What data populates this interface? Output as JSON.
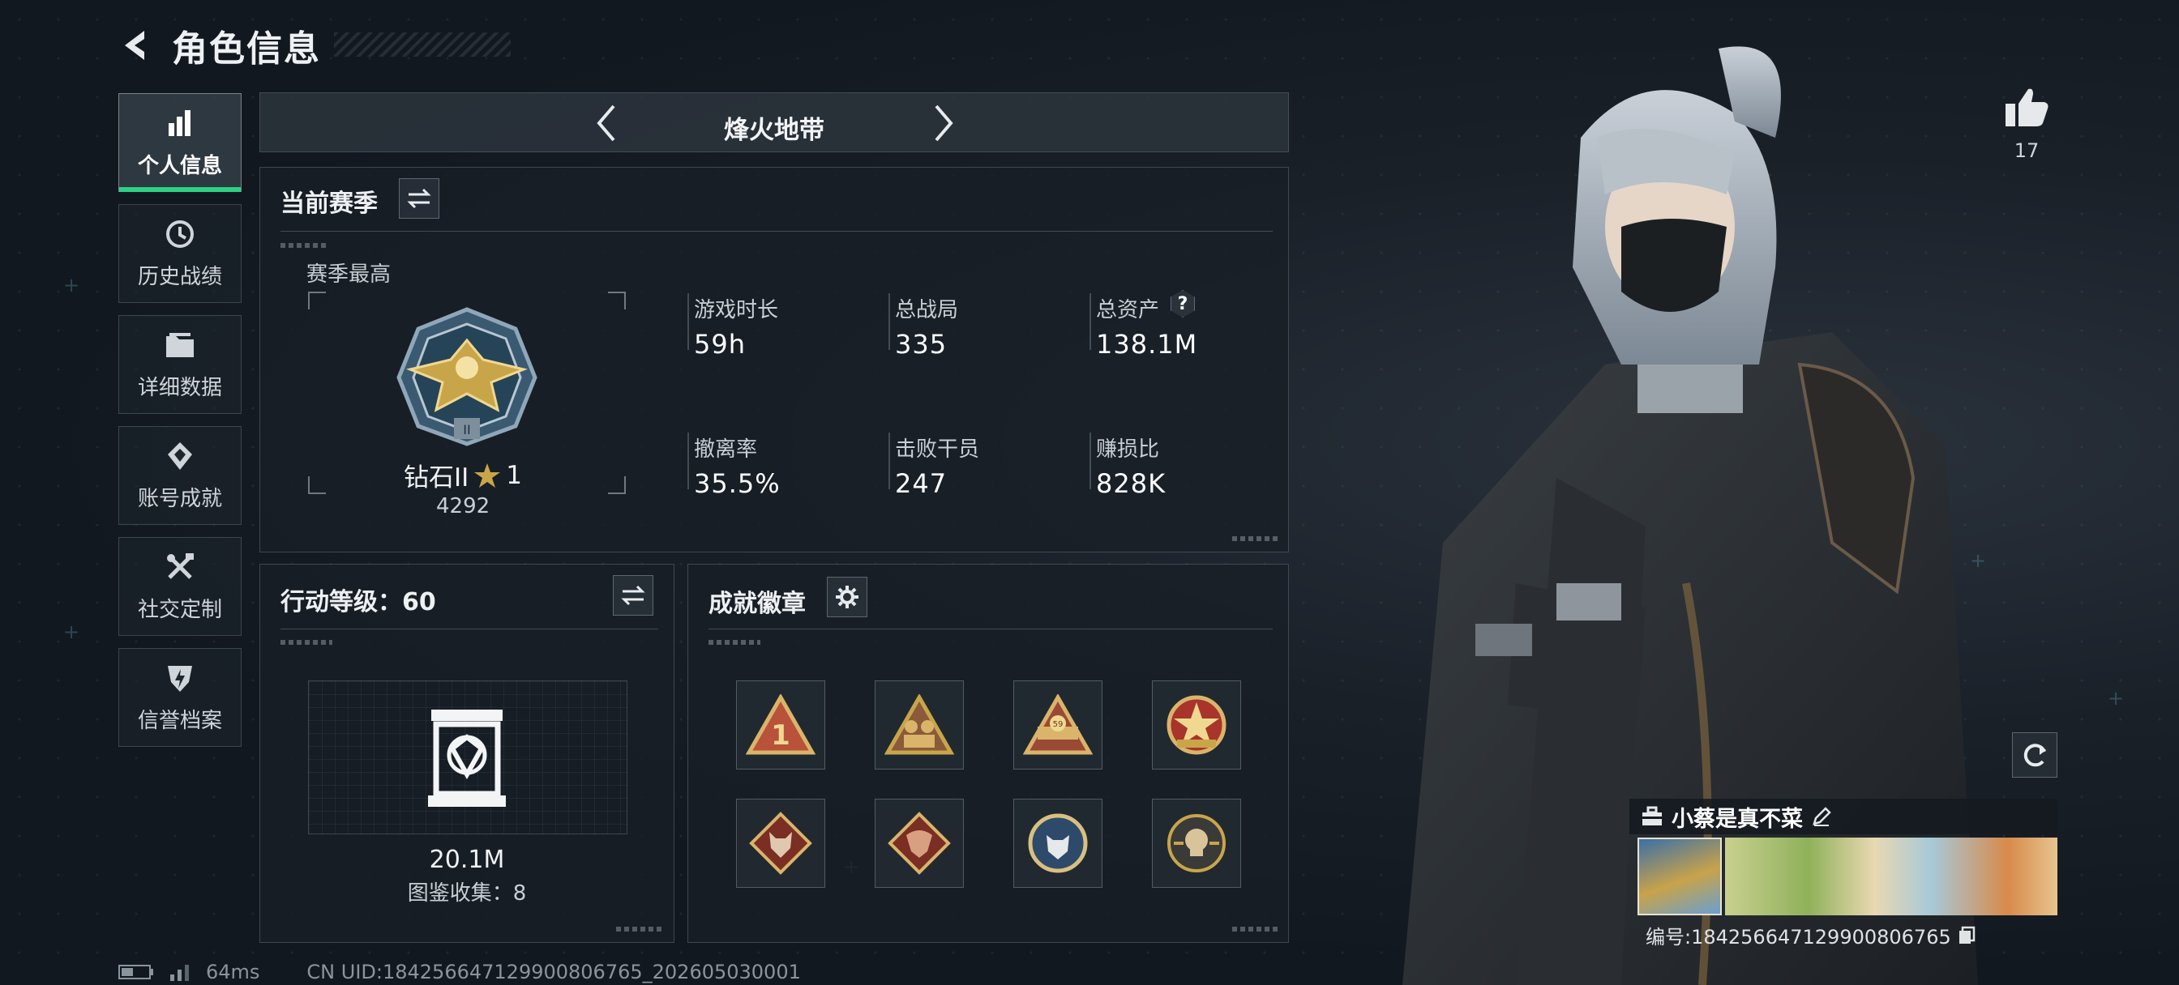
{
  "header": {
    "title": "角色信息"
  },
  "sidebar": {
    "items": [
      {
        "label": "个人信息",
        "icon": "bar-chart-icon",
        "active": true
      },
      {
        "label": "历史战绩",
        "icon": "history-clock-icon"
      },
      {
        "label": "详细数据",
        "icon": "folder-icon"
      },
      {
        "label": "账号成就",
        "icon": "achievement-icon"
      },
      {
        "label": "社交定制",
        "icon": "tools-icon"
      },
      {
        "label": "信誉档案",
        "icon": "shield-icon"
      }
    ]
  },
  "mode": {
    "title": "烽火地带"
  },
  "season": {
    "title": "当前赛季",
    "best_label": "赛季最高",
    "rank_name": "钻石II",
    "rank_stars": "1",
    "rank_score": "4292",
    "stats": [
      {
        "label": "游戏时长",
        "value": "59h"
      },
      {
        "label": "总战局",
        "value": "335"
      },
      {
        "label": "总资产",
        "value": "138.1M",
        "help": "?"
      },
      {
        "label": "撤离率",
        "value": "35.5%"
      },
      {
        "label": "击败干员",
        "value": "247"
      },
      {
        "label": "赚损比",
        "value": "828K"
      }
    ]
  },
  "level": {
    "title": "行动等级：60",
    "value": "20.1M",
    "collection": "图鉴收集：8"
  },
  "achievements": {
    "title": "成就徽章",
    "badges": [
      "rank-one-badge",
      "team-badge",
      "tier-59-badge",
      "star-emblem-badge",
      "wolf-badge",
      "dragon-badge",
      "wolf-medal-badge",
      "skull-badge"
    ]
  },
  "likes": {
    "count": "17"
  },
  "player": {
    "name": "小蔡是真不菜",
    "id_label": "编号:18425664712990080676​5"
  },
  "status": {
    "ping": "64ms",
    "uid": "CN UID:18425664712990080676​5_202605030001"
  },
  "colors": {
    "accent": "#2fd184",
    "gold": "#c9a54a"
  }
}
